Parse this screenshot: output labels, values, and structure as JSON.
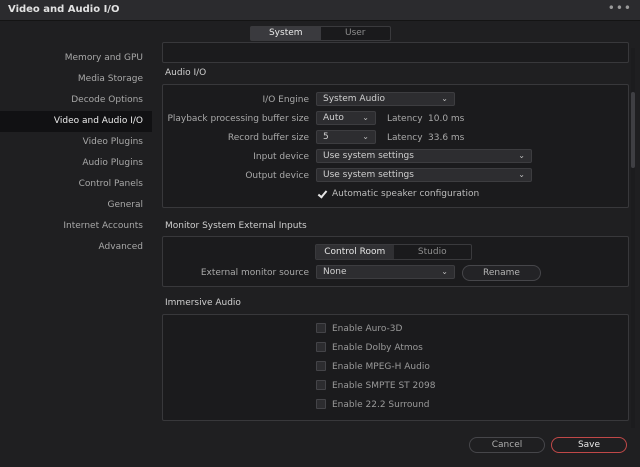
{
  "window": {
    "title": "Video and Audio I/O",
    "more_icon": "more-dots-icon"
  },
  "top_tabs": [
    {
      "label": "System",
      "active": true
    },
    {
      "label": "User",
      "active": false
    }
  ],
  "sidebar": {
    "items": [
      {
        "label": "Memory and GPU"
      },
      {
        "label": "Media Storage"
      },
      {
        "label": "Decode Options"
      },
      {
        "label": "Video and Audio I/O",
        "active": true
      },
      {
        "label": "Video Plugins"
      },
      {
        "label": "Audio Plugins"
      },
      {
        "label": "Control Panels"
      },
      {
        "label": "General"
      },
      {
        "label": "Internet Accounts"
      },
      {
        "label": "Advanced"
      }
    ]
  },
  "audio_io": {
    "title": "Audio I/O",
    "io_engine": {
      "label": "I/O Engine",
      "value": "System Audio"
    },
    "playback_buffer": {
      "label": "Playback processing buffer size",
      "value": "Auto",
      "latency_label": "Latency",
      "latency_value": "10.0 ms"
    },
    "record_buffer": {
      "label": "Record buffer size",
      "value": "5",
      "latency_label": "Latency",
      "latency_value": "33.6 ms"
    },
    "input_device": {
      "label": "Input device",
      "value": "Use system settings"
    },
    "output_device": {
      "label": "Output device",
      "value": "Use system settings"
    },
    "auto_speaker": {
      "label": "Automatic speaker configuration",
      "checked": true
    }
  },
  "monitor": {
    "title": "Monitor System External Inputs",
    "tabs": [
      {
        "label": "Control Room",
        "active": true
      },
      {
        "label": "Studio",
        "active": false
      }
    ],
    "external_source": {
      "label": "External monitor source",
      "value": "None"
    },
    "rename_label": "Rename"
  },
  "immersive": {
    "title": "Immersive Audio",
    "options": [
      {
        "label": "Enable Auro-3D",
        "checked": false
      },
      {
        "label": "Enable Dolby Atmos",
        "checked": false
      },
      {
        "label": "Enable MPEG-H Audio",
        "checked": false
      },
      {
        "label": "Enable SMPTE ST 2098",
        "checked": false
      },
      {
        "label": "Enable 22.2 Surround",
        "checked": false
      }
    ]
  },
  "footer": {
    "cancel_label": "Cancel",
    "save_label": "Save"
  },
  "colors": {
    "accent": "#c04848",
    "background": "#1f1f21",
    "panel": "#1b1b1d"
  }
}
